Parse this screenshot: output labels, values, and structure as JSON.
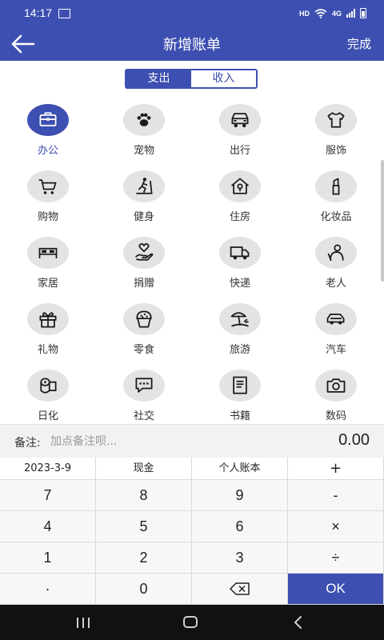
{
  "status_bar": {
    "time": "14:17",
    "network": "HD",
    "network2": "4G"
  },
  "header": {
    "title": "新增账单",
    "done_label": "完成"
  },
  "tabs": [
    {
      "label": "支出",
      "selected": true
    },
    {
      "label": "收入",
      "selected": false
    }
  ],
  "categories": [
    {
      "label": "办公",
      "icon": "briefcase-icon",
      "selected": true
    },
    {
      "label": "宠物",
      "icon": "paw-icon",
      "selected": false
    },
    {
      "label": "出行",
      "icon": "car-icon",
      "selected": false
    },
    {
      "label": "服饰",
      "icon": "shirt-icon",
      "selected": false
    },
    {
      "label": "购物",
      "icon": "cart-icon",
      "selected": false
    },
    {
      "label": "健身",
      "icon": "treadmill-icon",
      "selected": false
    },
    {
      "label": "住房",
      "icon": "house-icon",
      "selected": false
    },
    {
      "label": "化妆品",
      "icon": "lipstick-icon",
      "selected": false
    },
    {
      "label": "家居",
      "icon": "bed-icon",
      "selected": false
    },
    {
      "label": "捐赠",
      "icon": "hand-heart-icon",
      "selected": false
    },
    {
      "label": "快递",
      "icon": "truck-icon",
      "selected": false
    },
    {
      "label": "老人",
      "icon": "elder-icon",
      "selected": false
    },
    {
      "label": "礼物",
      "icon": "gift-icon",
      "selected": false
    },
    {
      "label": "零食",
      "icon": "muffin-icon",
      "selected": false
    },
    {
      "label": "旅游",
      "icon": "beach-icon",
      "selected": false
    },
    {
      "label": "汽车",
      "icon": "automobile-icon",
      "selected": false
    },
    {
      "label": "日化",
      "icon": "tissue-roll-icon",
      "selected": false
    },
    {
      "label": "社交",
      "icon": "chat-icon",
      "selected": false
    },
    {
      "label": "书籍",
      "icon": "book-icon",
      "selected": false
    },
    {
      "label": "数码",
      "icon": "camera-icon",
      "selected": false
    }
  ],
  "note": {
    "label": "备注:",
    "placeholder": "加点备注呗...",
    "value": ""
  },
  "amount": "0.00",
  "keypad": {
    "top_row": [
      "2023-3-9",
      "现金",
      "个人账本",
      "+"
    ],
    "rows": [
      [
        "7",
        "8",
        "9",
        "-"
      ],
      [
        "4",
        "5",
        "6",
        "×"
      ],
      [
        "1",
        "2",
        "3",
        "÷"
      ],
      [
        "·",
        "0",
        "",
        "OK"
      ]
    ]
  },
  "colors": {
    "primary": "#3d4fb0",
    "circle_bg": "#e3e3e3",
    "keypad_bg": "#f7f7f7"
  }
}
